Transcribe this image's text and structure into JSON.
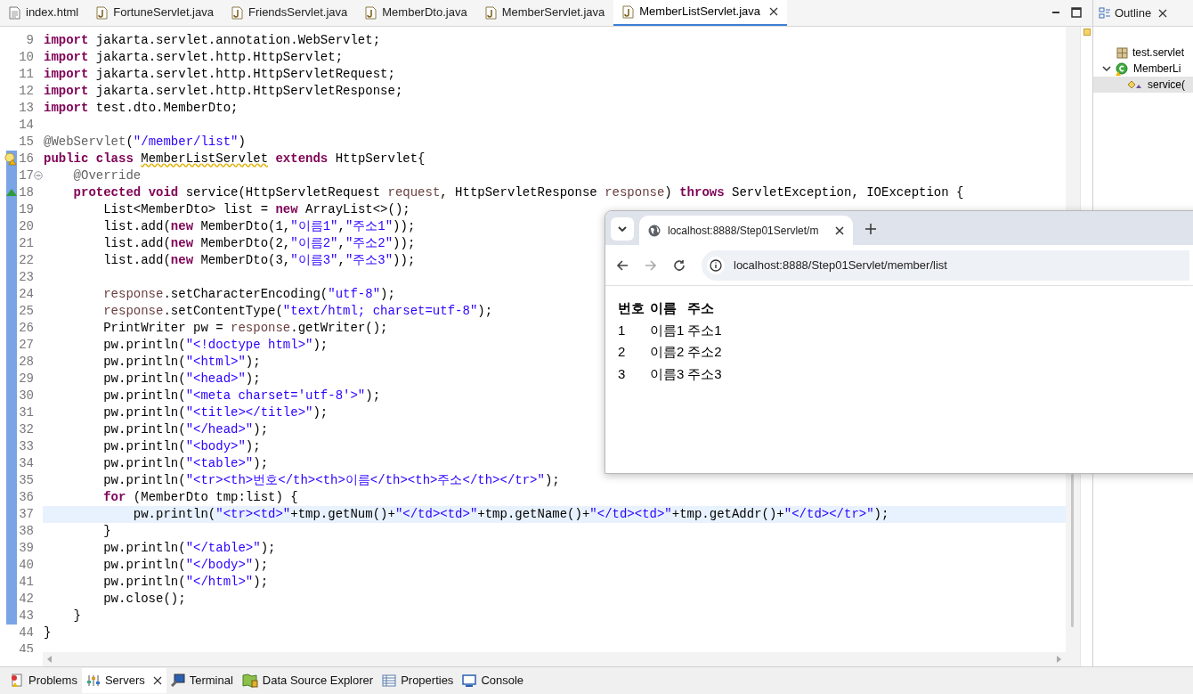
{
  "editor_tabs": [
    {
      "label": "index.html",
      "kind": "html",
      "selected": false
    },
    {
      "label": "FortuneServlet.java",
      "kind": "java",
      "selected": false
    },
    {
      "label": "FriendsServlet.java",
      "kind": "java",
      "selected": false
    },
    {
      "label": "MemberDto.java",
      "kind": "java",
      "selected": false
    },
    {
      "label": "MemberServlet.java",
      "kind": "java",
      "selected": false
    },
    {
      "label": "MemberListServlet.java",
      "kind": "java",
      "selected": true
    }
  ],
  "code_lines": [
    {
      "number": "9",
      "kind": "plain",
      "fold": false,
      "changed": false,
      "current": false,
      "tokens": [
        {
          "kind": "keyword",
          "text": "import"
        },
        {
          "kind": "plain",
          "text": " jakarta.servlet.annotation.WebServlet;"
        }
      ]
    },
    {
      "number": "10",
      "kind": "plain",
      "fold": false,
      "changed": false,
      "current": false,
      "tokens": [
        {
          "kind": "keyword",
          "text": "import"
        },
        {
          "kind": "plain",
          "text": " jakarta.servlet.http.HttpServlet;"
        }
      ]
    },
    {
      "number": "11",
      "kind": "plain",
      "fold": false,
      "changed": false,
      "current": false,
      "tokens": [
        {
          "kind": "keyword",
          "text": "import"
        },
        {
          "kind": "plain",
          "text": " jakarta.servlet.http.HttpServletRequest;"
        }
      ]
    },
    {
      "number": "12",
      "kind": "plain",
      "fold": false,
      "changed": false,
      "current": false,
      "tokens": [
        {
          "kind": "keyword",
          "text": "import"
        },
        {
          "kind": "plain",
          "text": " jakarta.servlet.http.HttpServletResponse;"
        }
      ]
    },
    {
      "number": "13",
      "kind": "plain",
      "fold": false,
      "changed": false,
      "current": false,
      "tokens": [
        {
          "kind": "keyword",
          "text": "import"
        },
        {
          "kind": "plain",
          "text": " test.dto.MemberDto;"
        }
      ]
    },
    {
      "number": "14",
      "kind": "plain",
      "fold": false,
      "changed": false,
      "current": false
    },
    {
      "number": "15",
      "kind": "plain",
      "fold": false,
      "changed": false,
      "current": false,
      "tokens": [
        {
          "kind": "annotation",
          "text": "@WebServlet"
        },
        {
          "kind": "plain",
          "text": "("
        },
        {
          "kind": "string",
          "text": "\"/member/list\""
        },
        {
          "kind": "plain",
          "text": ")"
        }
      ]
    },
    {
      "number": "16",
      "kind": "warning",
      "fold": false,
      "changed": true,
      "current": false,
      "tokens": [
        {
          "kind": "keyword",
          "text": "public "
        },
        {
          "kind": "keyword",
          "text": "class "
        },
        {
          "kind": "warning",
          "text": "MemberListServlet"
        },
        {
          "kind": "keyword",
          "text": " extends"
        },
        {
          "kind": "plain",
          "text": " HttpServlet{"
        }
      ]
    },
    {
      "number": "17",
      "kind": "plain",
      "fold": true,
      "changed": true,
      "current": false,
      "tokens": [
        {
          "kind": "annotation",
          "text": "    @Override"
        }
      ]
    },
    {
      "number": "18",
      "kind": "override",
      "fold": false,
      "changed": true,
      "current": false,
      "tokens": [
        {
          "kind": "keyword",
          "text": "    protected "
        },
        {
          "kind": "keyword",
          "text": "void"
        },
        {
          "kind": "plain",
          "text": " service(HttpServletRequest "
        },
        {
          "kind": "param",
          "text": "request"
        },
        {
          "kind": "plain",
          "text": ", HttpServletResponse "
        },
        {
          "kind": "param",
          "text": "response"
        },
        {
          "kind": "plain",
          "text": ") "
        },
        {
          "kind": "keyword",
          "text": "throws"
        },
        {
          "kind": "plain",
          "text": " ServletException, IOException {"
        }
      ]
    },
    {
      "number": "19",
      "kind": "plain",
      "fold": false,
      "changed": true,
      "current": false,
      "tokens": [
        {
          "kind": "plain",
          "text": "        List<MemberDto> list = "
        },
        {
          "kind": "keyword",
          "text": "new"
        },
        {
          "kind": "plain",
          "text": " ArrayList<>();"
        }
      ]
    },
    {
      "number": "20",
      "kind": "plain",
      "fold": false,
      "changed": true,
      "current": false,
      "tokens": [
        {
          "kind": "plain",
          "text": "        list.add("
        },
        {
          "kind": "keyword",
          "text": "new"
        },
        {
          "kind": "plain",
          "text": " MemberDto(1,"
        },
        {
          "kind": "string",
          "text": "\"이름1\""
        },
        {
          "kind": "plain",
          "text": ","
        },
        {
          "kind": "string",
          "text": "\"주소1\""
        },
        {
          "kind": "plain",
          "text": "));"
        }
      ]
    },
    {
      "number": "21",
      "kind": "plain",
      "fold": false,
      "changed": true,
      "current": false,
      "tokens": [
        {
          "kind": "plain",
          "text": "        list.add("
        },
        {
          "kind": "keyword",
          "text": "new"
        },
        {
          "kind": "plain",
          "text": " MemberDto(2,"
        },
        {
          "kind": "string",
          "text": "\"이름2\""
        },
        {
          "kind": "plain",
          "text": ","
        },
        {
          "kind": "string",
          "text": "\"주소2\""
        },
        {
          "kind": "plain",
          "text": "));"
        }
      ]
    },
    {
      "number": "22",
      "kind": "plain",
      "fold": false,
      "changed": true,
      "current": false,
      "tokens": [
        {
          "kind": "plain",
          "text": "        list.add("
        },
        {
          "kind": "keyword",
          "text": "new"
        },
        {
          "kind": "plain",
          "text": " MemberDto(3,"
        },
        {
          "kind": "string",
          "text": "\"이름3\""
        },
        {
          "kind": "plain",
          "text": ","
        },
        {
          "kind": "string",
          "text": "\"주소3\""
        },
        {
          "kind": "plain",
          "text": "));"
        }
      ]
    },
    {
      "number": "23",
      "kind": "plain",
      "fold": false,
      "changed": true,
      "current": false
    },
    {
      "number": "24",
      "kind": "plain",
      "fold": false,
      "changed": true,
      "current": false,
      "tokens": [
        {
          "kind": "param",
          "text": "        response"
        },
        {
          "kind": "plain",
          "text": ".setCharacterEncoding("
        },
        {
          "kind": "string",
          "text": "\"utf-8\""
        },
        {
          "kind": "plain",
          "text": ");"
        }
      ]
    },
    {
      "number": "25",
      "kind": "plain",
      "fold": false,
      "changed": true,
      "current": false,
      "tokens": [
        {
          "kind": "param",
          "text": "        response"
        },
        {
          "kind": "plain",
          "text": ".setContentType("
        },
        {
          "kind": "string",
          "text": "\"text/html; charset=utf-8\""
        },
        {
          "kind": "plain",
          "text": ");"
        }
      ]
    },
    {
      "number": "26",
      "kind": "plain",
      "fold": false,
      "changed": true,
      "current": false,
      "tokens": [
        {
          "kind": "plain",
          "text": "        PrintWriter pw = "
        },
        {
          "kind": "param",
          "text": "response"
        },
        {
          "kind": "plain",
          "text": ".getWriter();"
        }
      ]
    },
    {
      "number": "27",
      "kind": "plain",
      "fold": false,
      "changed": true,
      "current": false,
      "tokens": [
        {
          "kind": "plain",
          "text": "        pw.println("
        },
        {
          "kind": "string",
          "text": "\"<!doctype html>\""
        },
        {
          "kind": "plain",
          "text": ");"
        }
      ]
    },
    {
      "number": "28",
      "kind": "plain",
      "fold": false,
      "changed": true,
      "current": false,
      "tokens": [
        {
          "kind": "plain",
          "text": "        pw.println("
        },
        {
          "kind": "string",
          "text": "\"<html>\""
        },
        {
          "kind": "plain",
          "text": ");"
        }
      ]
    },
    {
      "number": "29",
      "kind": "plain",
      "fold": false,
      "changed": true,
      "current": false,
      "tokens": [
        {
          "kind": "plain",
          "text": "        pw.println("
        },
        {
          "kind": "string",
          "text": "\"<head>\""
        },
        {
          "kind": "plain",
          "text": ");"
        }
      ]
    },
    {
      "number": "30",
      "kind": "plain",
      "fold": false,
      "changed": true,
      "current": false,
      "tokens": [
        {
          "kind": "plain",
          "text": "        pw.println("
        },
        {
          "kind": "string",
          "text": "\"<meta charset='utf-8'>\""
        },
        {
          "kind": "plain",
          "text": ");"
        }
      ]
    },
    {
      "number": "31",
      "kind": "plain",
      "fold": false,
      "changed": true,
      "current": false,
      "tokens": [
        {
          "kind": "plain",
          "text": "        pw.println("
        },
        {
          "kind": "string",
          "text": "\"<title></title>\""
        },
        {
          "kind": "plain",
          "text": ");"
        }
      ]
    },
    {
      "number": "32",
      "kind": "plain",
      "fold": false,
      "changed": true,
      "current": false,
      "tokens": [
        {
          "kind": "plain",
          "text": "        pw.println("
        },
        {
          "kind": "string",
          "text": "\"</head>\""
        },
        {
          "kind": "plain",
          "text": ");"
        }
      ]
    },
    {
      "number": "33",
      "kind": "plain",
      "fold": false,
      "changed": true,
      "current": false,
      "tokens": [
        {
          "kind": "plain",
          "text": "        pw.println("
        },
        {
          "kind": "string",
          "text": "\"<body>\""
        },
        {
          "kind": "plain",
          "text": ");"
        }
      ]
    },
    {
      "number": "34",
      "kind": "plain",
      "fold": false,
      "changed": true,
      "current": false,
      "tokens": [
        {
          "kind": "plain",
          "text": "        pw.println("
        },
        {
          "kind": "string",
          "text": "\"<table>\""
        },
        {
          "kind": "plain",
          "text": ");"
        }
      ]
    },
    {
      "number": "35",
      "kind": "plain",
      "fold": false,
      "changed": true,
      "current": false,
      "tokens": [
        {
          "kind": "plain",
          "text": "        pw.println("
        },
        {
          "kind": "string",
          "text": "\"<tr><th>번호</th><th>이름</th><th>주소</th></tr>\""
        },
        {
          "kind": "plain",
          "text": ");"
        }
      ]
    },
    {
      "number": "36",
      "kind": "plain",
      "fold": false,
      "changed": true,
      "current": false,
      "tokens": [
        {
          "kind": "keyword",
          "text": "        for"
        },
        {
          "kind": "plain",
          "text": " (MemberDto tmp:list) {"
        }
      ]
    },
    {
      "number": "37",
      "kind": "plain",
      "fold": false,
      "changed": true,
      "current": true,
      "tokens": [
        {
          "kind": "plain",
          "text": "            pw.println("
        },
        {
          "kind": "string",
          "text": "\"<tr><td>\""
        },
        {
          "kind": "plain",
          "text": "+tmp.getNum()+"
        },
        {
          "kind": "string",
          "text": "\"</td><td>\""
        },
        {
          "kind": "plain",
          "text": "+tmp.getName()+"
        },
        {
          "kind": "string",
          "text": "\"</td><td>\""
        },
        {
          "kind": "plain",
          "text": "+tmp.getAddr()+"
        },
        {
          "kind": "string",
          "text": "\"</td></tr>\""
        },
        {
          "kind": "plain",
          "text": ");"
        }
      ]
    },
    {
      "number": "38",
      "kind": "plain",
      "fold": false,
      "changed": true,
      "current": false,
      "tokens": [
        {
          "kind": "plain",
          "text": "        }"
        }
      ]
    },
    {
      "number": "39",
      "kind": "plain",
      "fold": false,
      "changed": true,
      "current": false,
      "tokens": [
        {
          "kind": "plain",
          "text": "        pw.println("
        },
        {
          "kind": "string",
          "text": "\"</table>\""
        },
        {
          "kind": "plain",
          "text": ");"
        }
      ]
    },
    {
      "number": "40",
      "kind": "plain",
      "fold": false,
      "changed": true,
      "current": false,
      "tokens": [
        {
          "kind": "plain",
          "text": "        pw.println("
        },
        {
          "kind": "string",
          "text": "\"</body>\""
        },
        {
          "kind": "plain",
          "text": ");"
        }
      ]
    },
    {
      "number": "41",
      "kind": "plain",
      "fold": false,
      "changed": true,
      "current": false,
      "tokens": [
        {
          "kind": "plain",
          "text": "        pw.println("
        },
        {
          "kind": "string",
          "text": "\"</html>\""
        },
        {
          "kind": "plain",
          "text": ");"
        }
      ]
    },
    {
      "number": "42",
      "kind": "plain",
      "fold": false,
      "changed": true,
      "current": false,
      "tokens": [
        {
          "kind": "plain",
          "text": "        pw.close();"
        }
      ]
    },
    {
      "number": "43",
      "kind": "plain",
      "fold": false,
      "changed": true,
      "current": false,
      "tokens": [
        {
          "kind": "plain",
          "text": "    }"
        }
      ]
    },
    {
      "number": "44",
      "kind": "plain",
      "fold": false,
      "changed": false,
      "current": false,
      "tokens": [
        {
          "kind": "plain",
          "text": "}"
        }
      ]
    },
    {
      "number": "45",
      "kind": "plain",
      "fold": false,
      "changed": false,
      "current": false
    }
  ],
  "outline": {
    "title": "Outline",
    "items": [
      {
        "label": "test.servlet",
        "kind": "package",
        "selected": false
      },
      {
        "label": "MemberLi",
        "kind": "class",
        "expanded": true,
        "selected": false,
        "children": [
          {
            "label": "service(",
            "kind": "method",
            "selected": true
          }
        ]
      }
    ]
  },
  "browser": {
    "tab_title": "localhost:8888/Step01Servlet/m",
    "address": "localhost:8888/Step01Servlet/member/list",
    "table": {
      "columns": [
        "번호",
        "이름",
        "주소"
      ],
      "rows": [
        [
          "1",
          "이름1",
          "주소1"
        ],
        [
          "2",
          "이름2",
          "주소2"
        ],
        [
          "3",
          "이름3",
          "주소3"
        ]
      ]
    }
  },
  "bottom_tabs": [
    {
      "label": "Problems",
      "kind": "problems",
      "selected": false
    },
    {
      "label": "Servers",
      "kind": "servers",
      "selected": true
    },
    {
      "label": "Terminal",
      "kind": "terminal",
      "selected": false
    },
    {
      "label": "Data Source Explorer",
      "kind": "datasource",
      "selected": false
    },
    {
      "label": "Properties",
      "kind": "properties",
      "selected": false
    },
    {
      "label": "Console",
      "kind": "console",
      "selected": false
    }
  ]
}
